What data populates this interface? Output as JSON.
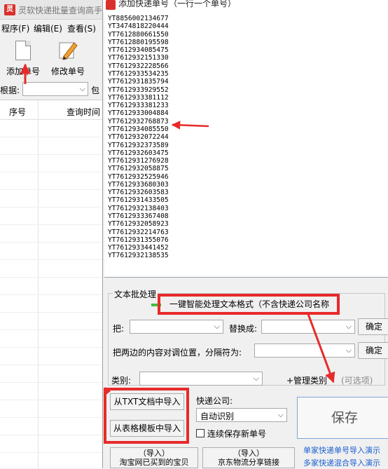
{
  "main_window": {
    "title": "灵软快递批量查询高手",
    "menu": [
      "程序(F)",
      "编辑(E)",
      "查看(S)"
    ],
    "toolbar": {
      "add_label": "添加单号",
      "edit_label": "修改单号"
    },
    "filter": {
      "label": "根据:",
      "extra": "包"
    },
    "grid": {
      "col_seq": "序号",
      "col_query_time": "查询时间"
    }
  },
  "dialog": {
    "title": "添加快递单号（一行一个单号）",
    "tracking_numbers": [
      "YT8856002134677",
      "YT3474818220444",
      "YT7612880661550",
      "YT7612880195598",
      "YT7612934085475",
      "YT7612932151330",
      "YT7612932228566",
      "YT7612933534235",
      "YT7612931835794",
      "YT7612933929552",
      "YT7612933381112",
      "YT7612933381233",
      "YT7612933004884",
      "YT7612932768873",
      "YT7612934085550",
      "YT7612932072244",
      "YT7612932373589",
      "YT7612932603475",
      "YT7612931276928",
      "YT7612932058875",
      "YT7612932525946",
      "YT7612933680303",
      "YT7612932603583",
      "YT7612931433505",
      "YT7612932138403",
      "YT7612933367408",
      "YT7612932058923",
      "YT7612932214763",
      "YT7612931355076",
      "YT7612933441452",
      "YT7612932138535"
    ],
    "text_batch": {
      "group_title": "文本批处理",
      "smart_button": "一键智能处理文本格式（不含快递公司名称",
      "replace_label": "把:",
      "replace_with_label": "替换成:",
      "confirm_label": "确定",
      "swap_label": "把两边的内容对调位置，分隔符为:"
    },
    "category": {
      "label": "类别:",
      "manage_label": "+管理类别",
      "optional_label": "(可选项)"
    },
    "import": {
      "from_txt": "从TXT文档中导入",
      "from_template": "从表格模板中导入",
      "taobao_line1": "（导入）",
      "taobao_line2": "淘宝网已买到的宝贝",
      "jd_line1": "（导入）",
      "jd_line2": "京东物流分享链接"
    },
    "courier": {
      "label": "快递公司:",
      "selected": "自动识别",
      "continuous_save": "连续保存新单号"
    },
    "save_label": "保存",
    "help_links": {
      "single": "单家快递单号导入演示",
      "multi": "多家快递混合导入演示"
    }
  },
  "colors": {
    "annotation_red": "#e82a2a",
    "link_blue": "#1a5fd0",
    "save_border": "#7aa7d8"
  }
}
